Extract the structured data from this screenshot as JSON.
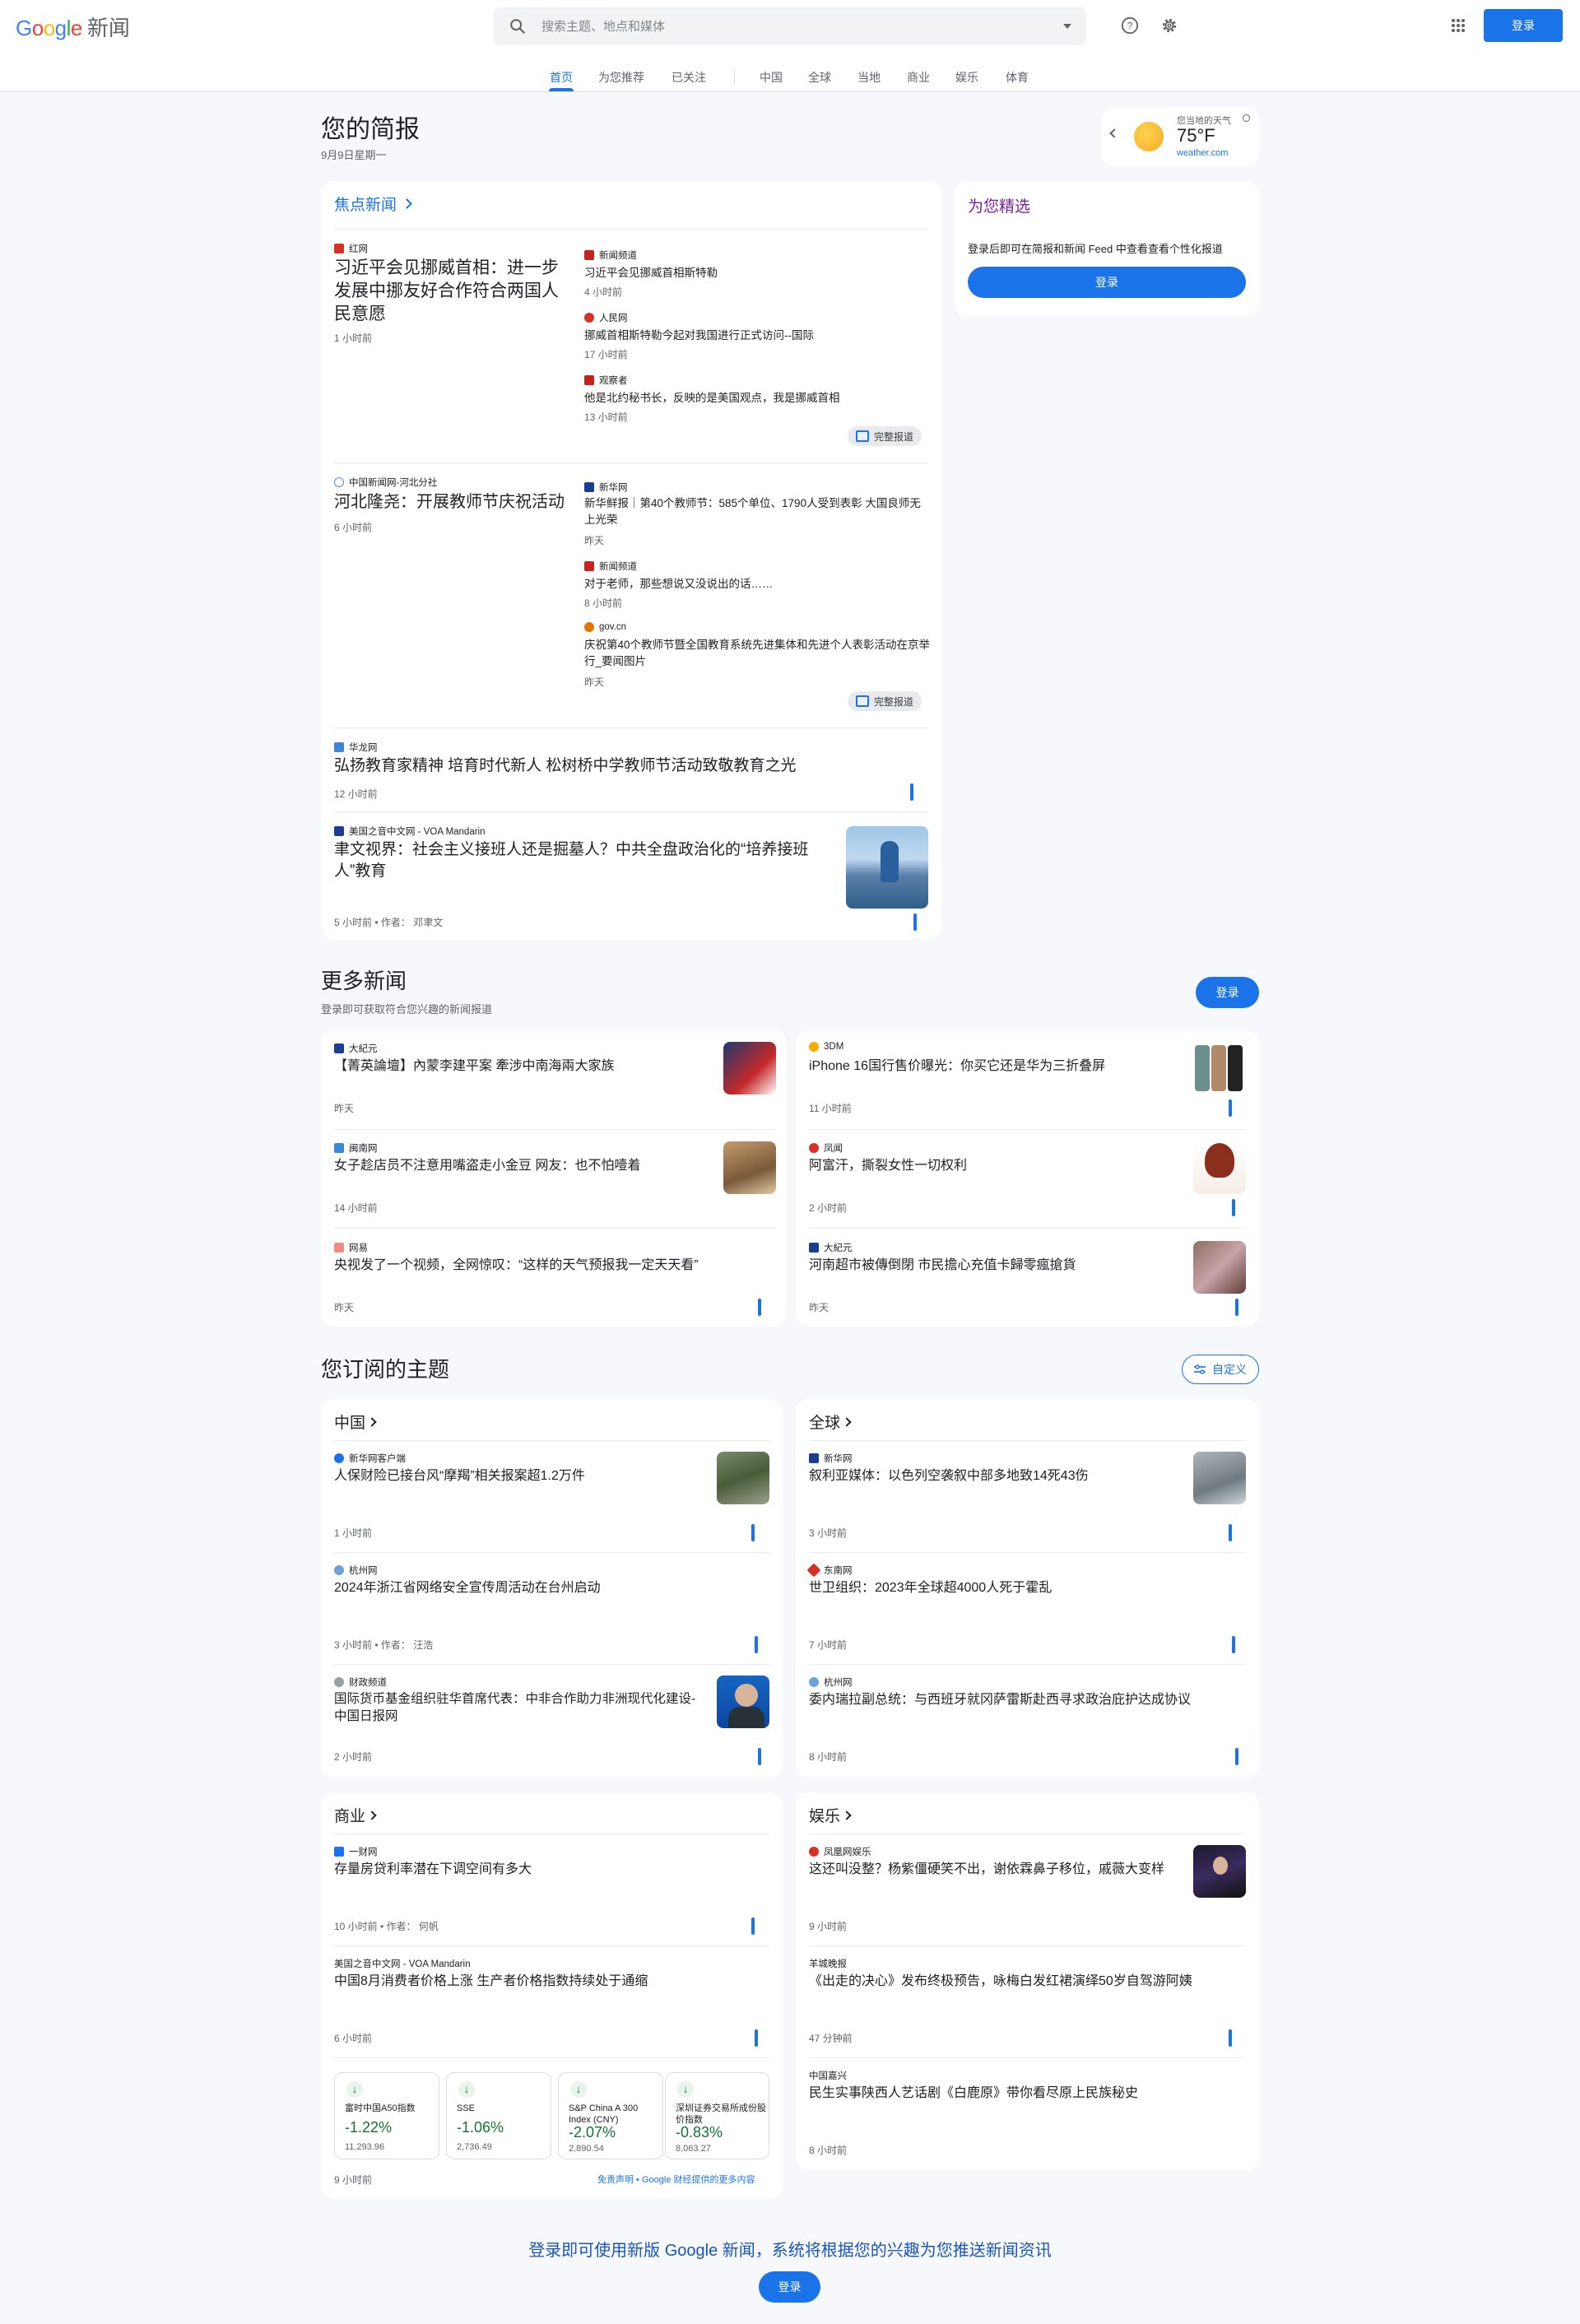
{
  "header": {
    "logo_google": "Google",
    "logo_news": "新闻",
    "search_placeholder": "搜索主题、地点和媒体",
    "login": "登录",
    "nav": [
      "首页",
      "为您推荐",
      "已关注",
      "中国",
      "全球",
      "当地",
      "商业",
      "娱乐",
      "体育"
    ]
  },
  "briefing": {
    "title": "您的简报",
    "date": "9月9日星期一"
  },
  "weather": {
    "label": "您当地的天气",
    "temp": "75°F",
    "source": "weather.com"
  },
  "foryou": {
    "title": "为您精选",
    "text": "登录后即可在简报和新闻 Feed 中查看查看个性化报道",
    "button": "登录"
  },
  "headlines": {
    "title": "焦点新闻",
    "full_coverage": "完整报道",
    "cluster1": {
      "main": {
        "source": "红网",
        "title": "习近平会见挪威首相：进一步发展中挪友好合作符合两国人民意愿",
        "time": "1 小时前"
      },
      "side": [
        {
          "source": "新闻频道",
          "title": "习近平会见挪威首相斯特勒",
          "time": "4 小时前"
        },
        {
          "source": "人民网",
          "title": "挪威首相斯特勒今起对我国进行正式访问--国际",
          "time": "17 小时前"
        },
        {
          "source": "观察者",
          "title": "他是北约秘书长，反映的是美国观点，我是挪威首相",
          "time": "13 小时前"
        }
      ]
    },
    "cluster2": {
      "main": {
        "source": "中国新闻网-河北分社",
        "title": "河北隆尧：开展教师节庆祝活动",
        "time": "6 小时前"
      },
      "side": [
        {
          "source": "新华网",
          "title": "新华鲜报｜第40个教师节：585个单位、1790人受到表彰 大国良师无上光荣",
          "time": "昨天"
        },
        {
          "source": "新闻频道",
          "title": "对于老师，那些想说又没说出的话……",
          "time": "8 小时前"
        },
        {
          "source": "gov.cn",
          "title": "庆祝第40个教师节暨全国教育系统先进集体和先进个人表彰活动在京举行_要闻图片",
          "time": "昨天"
        }
      ]
    },
    "single1": {
      "source": "华龙网",
      "title": "弘扬教育家精神 培育时代新人 松树桥中学教师节活动致敬教育之光",
      "time": "12 小时前"
    },
    "single2": {
      "source": "美国之音中文网 - VOA Mandarin",
      "title": "聿文视界：社会主义接班人还是掘墓人？中共全盘政治化的“培养接班人”教育",
      "time": "5 小时前 • 作者： 邓聿文"
    }
  },
  "more": {
    "title": "更多新闻",
    "subtitle": "登录即可获取符合您兴趣的新闻报道",
    "button": "登录",
    "items": [
      {
        "source": "大紀元",
        "title": "【菁英論壇】內蒙李建平案 牽涉中南海兩大家族",
        "time": "昨天"
      },
      {
        "source": "3DM",
        "title": "iPhone 16国行售价曝光：你买它还是华为三折叠屏",
        "time": "11 小时前"
      },
      {
        "source": "闽南网",
        "title": "女子趁店员不注意用嘴盗走小金豆 网友：也不怕噎着",
        "time": "14 小时前"
      },
      {
        "source": "凤闻",
        "title": "阿富汗，撕裂女性一切权利",
        "time": "2 小时前"
      },
      {
        "source": "网易",
        "title": "央视发了一个视频，全网惊叹：“这样的天气预报我一定天天看”",
        "time": "昨天"
      },
      {
        "source": "大紀元",
        "title": "河南超市被傳倒閉 市民擔心充值卡歸零瘋搶貨",
        "time": "昨天"
      }
    ]
  },
  "topics": {
    "title": "您订阅的主题",
    "customize": "自定义",
    "china": {
      "name": "中国",
      "items": [
        {
          "source": "新华网客户端",
          "title": "人保财险已接台风“摩羯”相关报案超1.2万件",
          "time": "1 小时前"
        },
        {
          "source": "杭州网",
          "title": "2024年浙江省网络安全宣传周活动在台州启动",
          "time": "3 小时前 • 作者： 汪浩"
        },
        {
          "source": "财政频道",
          "title": "国际货币基金组织驻华首席代表：中非合作助力非洲现代化建设- 中国日报网",
          "time": "2 小时前"
        }
      ]
    },
    "world": {
      "name": "全球",
      "items": [
        {
          "source": "新华网",
          "title": "叙利亚媒体：以色列空袭叙中部多地致14死43伤",
          "time": "3 小时前"
        },
        {
          "source": "东南网",
          "title": "世卫组织：2023年全球超4000人死于霍乱",
          "time": "7 小时前"
        },
        {
          "source": "杭州网",
          "title": "委内瑞拉副总统：与西班牙就冈萨雷斯赴西寻求政治庇护达成协议",
          "time": "8 小时前"
        }
      ]
    },
    "business": {
      "name": "商业",
      "items": [
        {
          "source": "一财网",
          "title": "存量房贷利率潜在下调空间有多大",
          "time": "10 小时前 • 作者： 何帆"
        },
        {
          "source": "美国之音中文网 - VOA Mandarin",
          "title": "中国8月消费者价格上涨 生产者价格指数持续处于通缩",
          "time": "6 小时前"
        }
      ],
      "stocks": [
        {
          "name": "富时中国A50指数",
          "change": "-1.22%",
          "value": "11,293.96"
        },
        {
          "name": "SSE",
          "change": "-1.06%",
          "value": "2,736.49"
        },
        {
          "name": "S&P China A 300 Index (CNY)",
          "change": "-2.07%",
          "value": "2,890.54"
        },
        {
          "name": "深圳证券交易所成份股价指数",
          "change": "-0.83%",
          "value": "8,063.27"
        }
      ],
      "stocks_time": "9 小时前",
      "stocks_disclaimer": "免责声明 • Google 财经提供的更多内容"
    },
    "entertainment": {
      "name": "娱乐",
      "items": [
        {
          "source": "凤凰网娱乐",
          "title": "这还叫没整？杨紫僵硬笑不出，谢依霖鼻子移位，戚薇大变样",
          "time": "9 小时前"
        },
        {
          "source": "羊城晚报",
          "title": "《出走的决心》发布终极预告，咏梅白发红裙演绎50岁自驾游阿姨",
          "time": "47 分钟前"
        },
        {
          "source": "中国嘉兴",
          "title": "民生实事陕西人艺话剧《白鹿原》带你看尽原上民族秘史",
          "time": "8 小时前"
        }
      ]
    }
  },
  "footer": {
    "text": "登录即可使用新版 Google 新闻，系统将根据您的兴趣为您推送新闻资讯",
    "button": "登录"
  }
}
